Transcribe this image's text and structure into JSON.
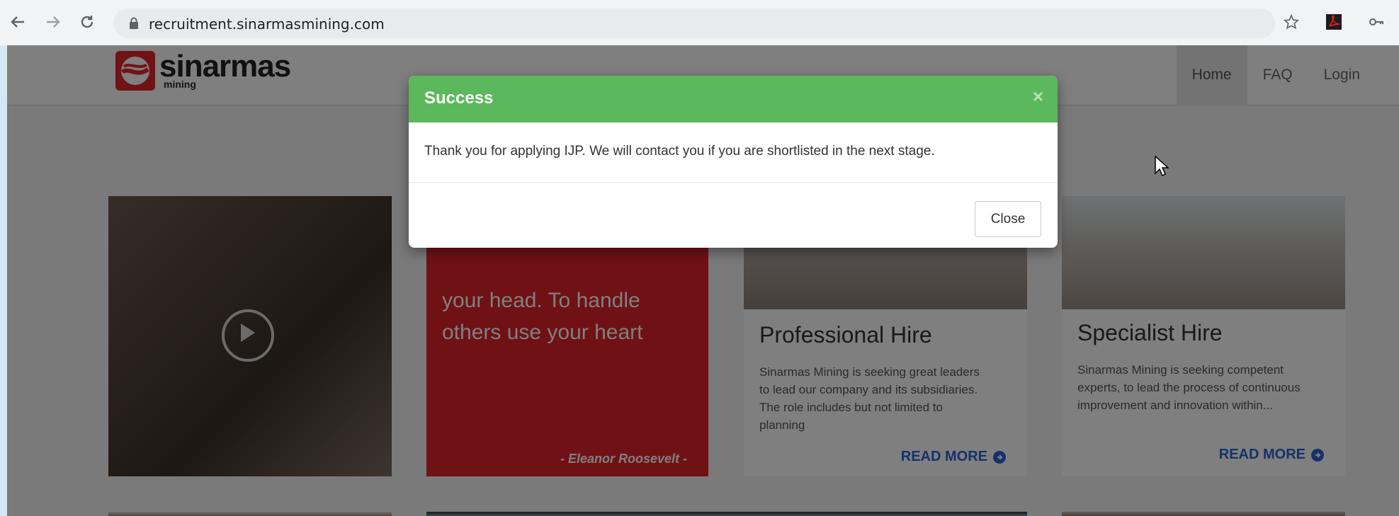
{
  "browser": {
    "url": "recruitment.sinarmasmining.com"
  },
  "site": {
    "logo_word": "sinarmas",
    "logo_sub": "mining",
    "nav": [
      {
        "label": "Home"
      },
      {
        "label": "FAQ"
      },
      {
        "label": "Login"
      }
    ]
  },
  "tiles": {
    "quote": {
      "line1": "your head. To handle",
      "line2": "others use your heart",
      "author": "- Eleanor Roosevelt -"
    },
    "professional": {
      "title": "Professional Hire",
      "text": "Sinarmas Mining is seeking great leaders to lead our company and its subsidiaries. The role includes but not limited to planning",
      "link": "READ MORE"
    },
    "specialist": {
      "title": "Specialist Hire",
      "text": "Sinarmas Mining is seeking competent experts, to lead the process of continuous improvement and innovation within...",
      "link": "READ MORE"
    }
  },
  "modal": {
    "title": "Success",
    "close_x": "×",
    "message": "Thank you for applying IJP. We will contact you if you are shortlisted in the next stage.",
    "close_label": "Close"
  },
  "colors": {
    "success": "#5cb85c",
    "brand_red": "#e1232a",
    "link_blue": "#2b63d9"
  }
}
